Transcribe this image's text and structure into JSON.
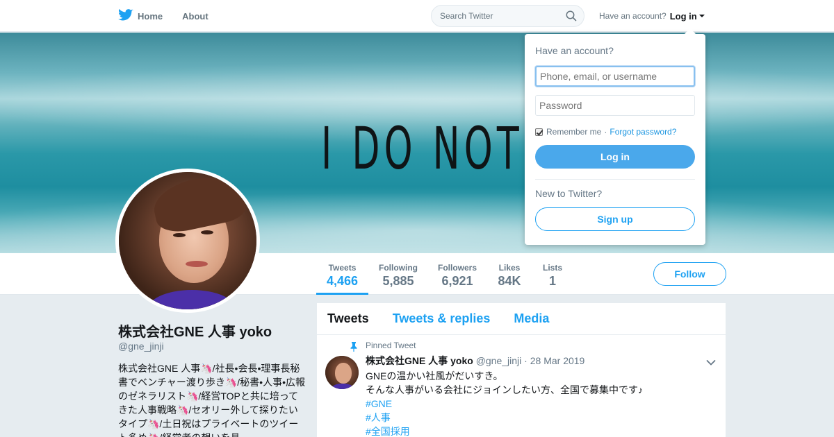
{
  "nav": {
    "home_label": "Home",
    "about_label": "About",
    "home_icon": "twitter-bird-icon"
  },
  "search": {
    "placeholder": "Search Twitter",
    "icon": "search-icon"
  },
  "account": {
    "prompt": "Have an account?",
    "login_label": "Log in"
  },
  "banner": {
    "text": "I DO NOT            FIND."
  },
  "stats": [
    {
      "label": "Tweets",
      "value": "4,466"
    },
    {
      "label": "Following",
      "value": "5,885"
    },
    {
      "label": "Followers",
      "value": "6,921"
    },
    {
      "label": "Likes",
      "value": "84K"
    },
    {
      "label": "Lists",
      "value": "1"
    }
  ],
  "follow_label": "Follow",
  "profile": {
    "name": "株式会社GNE 人事 yoko",
    "handle": "@gne_jinji",
    "bio": "株式会社GNE 人事🦄/社長•会長•理事長秘書でベンチャー渡り歩き🦄/秘書•人事•広報のゼネラリスト🦄/経営TOPと共に培ってきた人事戦略🦄/セオリー外して探りたいタイプ🦄/土日祝はプライベートのツイート多め🦄/経営者の想いを具"
  },
  "timeline": {
    "tabs": [
      "Tweets",
      "Tweets & replies",
      "Media"
    ],
    "pinned_label": "Pinned Tweet",
    "tweet": {
      "name": "株式会社GNE 人事 yoko",
      "handle": "@gne_jinji",
      "date": "28 Mar 2019",
      "line1": "GNEの温かい社風がだいすき。",
      "line2": "そんな人事がいる会社にジョインしたい方、全国で募集中です♪",
      "tags": [
        "#GNE",
        "#人事",
        "#全国採用"
      ]
    }
  },
  "login_dropdown": {
    "title": "Have an account?",
    "username_placeholder": "Phone, email, or username",
    "password_placeholder": "Password",
    "remember_label": "Remember me",
    "separator": "·",
    "forgot_label": "Forgot password?",
    "login_button": "Log in",
    "new_prompt": "New to Twitter?",
    "signup_button": "Sign up"
  },
  "colors": {
    "accent": "#1da1f2",
    "login_button": "#4aa8eb",
    "page_bg": "#e6ecf0"
  }
}
